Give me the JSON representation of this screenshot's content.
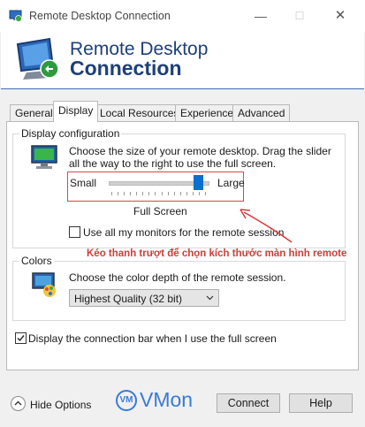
{
  "window": {
    "title": "Remote Desktop Connection",
    "minimize_glyph": "—",
    "maximize_glyph": "☐",
    "close_glyph": "✕"
  },
  "header": {
    "line1": "Remote Desktop",
    "line2": "Connection"
  },
  "tabs": [
    {
      "label": "General"
    },
    {
      "label": "Display",
      "active": true
    },
    {
      "label": "Local Resources"
    },
    {
      "label": "Experience"
    },
    {
      "label": "Advanced"
    }
  ],
  "display_config": {
    "legend": "Display configuration",
    "description": "Choose the size of your remote desktop. Drag the slider all the way to the right to use the full screen.",
    "slider_small_label": "Small",
    "slider_large_label": "Large",
    "slider_level": 0.92,
    "slider_value_label": "Full Screen",
    "all_monitors_label": "Use all my monitors for the remote session",
    "all_monitors_checked": false
  },
  "annotation": {
    "text": "Kéo thanh trượt để chọn kích thước màn hình remote",
    "color": "#d33b3b"
  },
  "colors": {
    "legend": "Colors",
    "description": "Choose the color depth of the remote session.",
    "selected_depth": "Highest Quality (32 bit)"
  },
  "connection_bar": {
    "label": "Display the connection bar when I use the full screen",
    "checked": true
  },
  "footer": {
    "hide_options_label": "Hide Options",
    "logo_badge": "VM",
    "logo_text": "VMon",
    "connect_label": "Connect",
    "help_label": "Help"
  },
  "accent_color": "#0b6ed0"
}
